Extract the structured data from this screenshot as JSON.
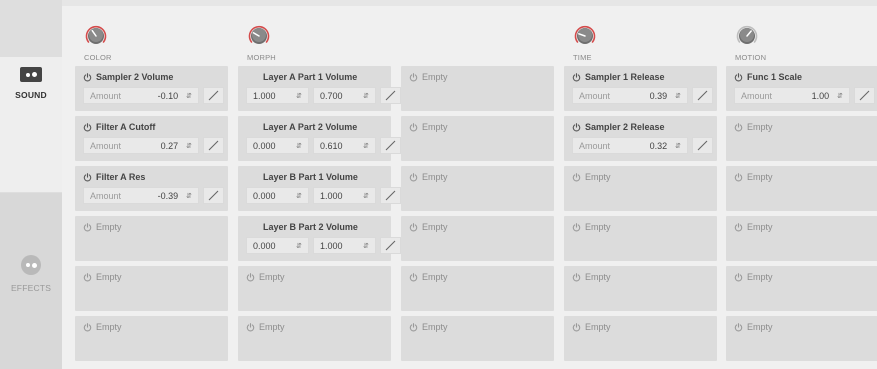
{
  "rail": {
    "sound_label": "SOUND",
    "effects_label": "EFFECTS",
    "active_tab": "SOUND"
  },
  "columns": [
    {
      "knob_label": "COLOR",
      "knob_accent": "#d44b4b",
      "slots": [
        {
          "type": "amount",
          "title": "Sampler 2 Volume",
          "label": "Amount",
          "value": "-0.10"
        },
        {
          "type": "amount",
          "title": "Filter A Cutoff",
          "label": "Amount",
          "value": "0.27"
        },
        {
          "type": "amount",
          "title": "Filter A Res",
          "label": "Amount",
          "value": "-0.39"
        },
        {
          "type": "empty",
          "title": "Empty"
        },
        {
          "type": "empty",
          "title": "Empty"
        },
        {
          "type": "empty",
          "title": "Empty"
        }
      ]
    },
    {
      "knob_label": "MORPH",
      "knob_accent": "#d44b4b",
      "slots": [
        {
          "type": "range",
          "title": "Layer A Part 1 Volume",
          "min": "1.000",
          "max": "0.700"
        },
        {
          "type": "range",
          "title": "Layer A Part 2 Volume",
          "min": "0.000",
          "max": "0.610"
        },
        {
          "type": "range",
          "title": "Layer B Part 1 Volume",
          "min": "0.000",
          "max": "1.000"
        },
        {
          "type": "range",
          "title": "Layer B Part 2 Volume",
          "min": "0.000",
          "max": "1.000"
        },
        {
          "type": "empty",
          "title": "Empty"
        },
        {
          "type": "empty",
          "title": "Empty"
        }
      ]
    },
    {
      "knob_label": "",
      "slots": [
        {
          "type": "empty",
          "title": "Empty"
        },
        {
          "type": "empty",
          "title": "Empty"
        },
        {
          "type": "empty",
          "title": "Empty"
        },
        {
          "type": "empty",
          "title": "Empty"
        },
        {
          "type": "empty",
          "title": "Empty"
        },
        {
          "type": "empty",
          "title": "Empty"
        }
      ]
    },
    {
      "knob_label": "TIME",
      "knob_accent": "#d44b4b",
      "slots": [
        {
          "type": "amount",
          "title": "Sampler 1 Release",
          "label": "Amount",
          "value": "0.39"
        },
        {
          "type": "amount",
          "title": "Sampler 2 Release",
          "label": "Amount",
          "value": "0.32"
        },
        {
          "type": "empty",
          "title": "Empty"
        },
        {
          "type": "empty",
          "title": "Empty"
        },
        {
          "type": "empty",
          "title": "Empty"
        },
        {
          "type": "empty",
          "title": "Empty"
        }
      ]
    },
    {
      "knob_label": "MOTION",
      "knob_accent": "#bdbdbd",
      "slots": [
        {
          "type": "amount",
          "title": "Func 1 Scale",
          "label": "Amount",
          "value": "1.00"
        },
        {
          "type": "empty",
          "title": "Empty"
        },
        {
          "type": "empty",
          "title": "Empty"
        },
        {
          "type": "empty",
          "title": "Empty"
        },
        {
          "type": "empty",
          "title": "Empty"
        },
        {
          "type": "empty",
          "title": "Empty"
        }
      ]
    }
  ]
}
